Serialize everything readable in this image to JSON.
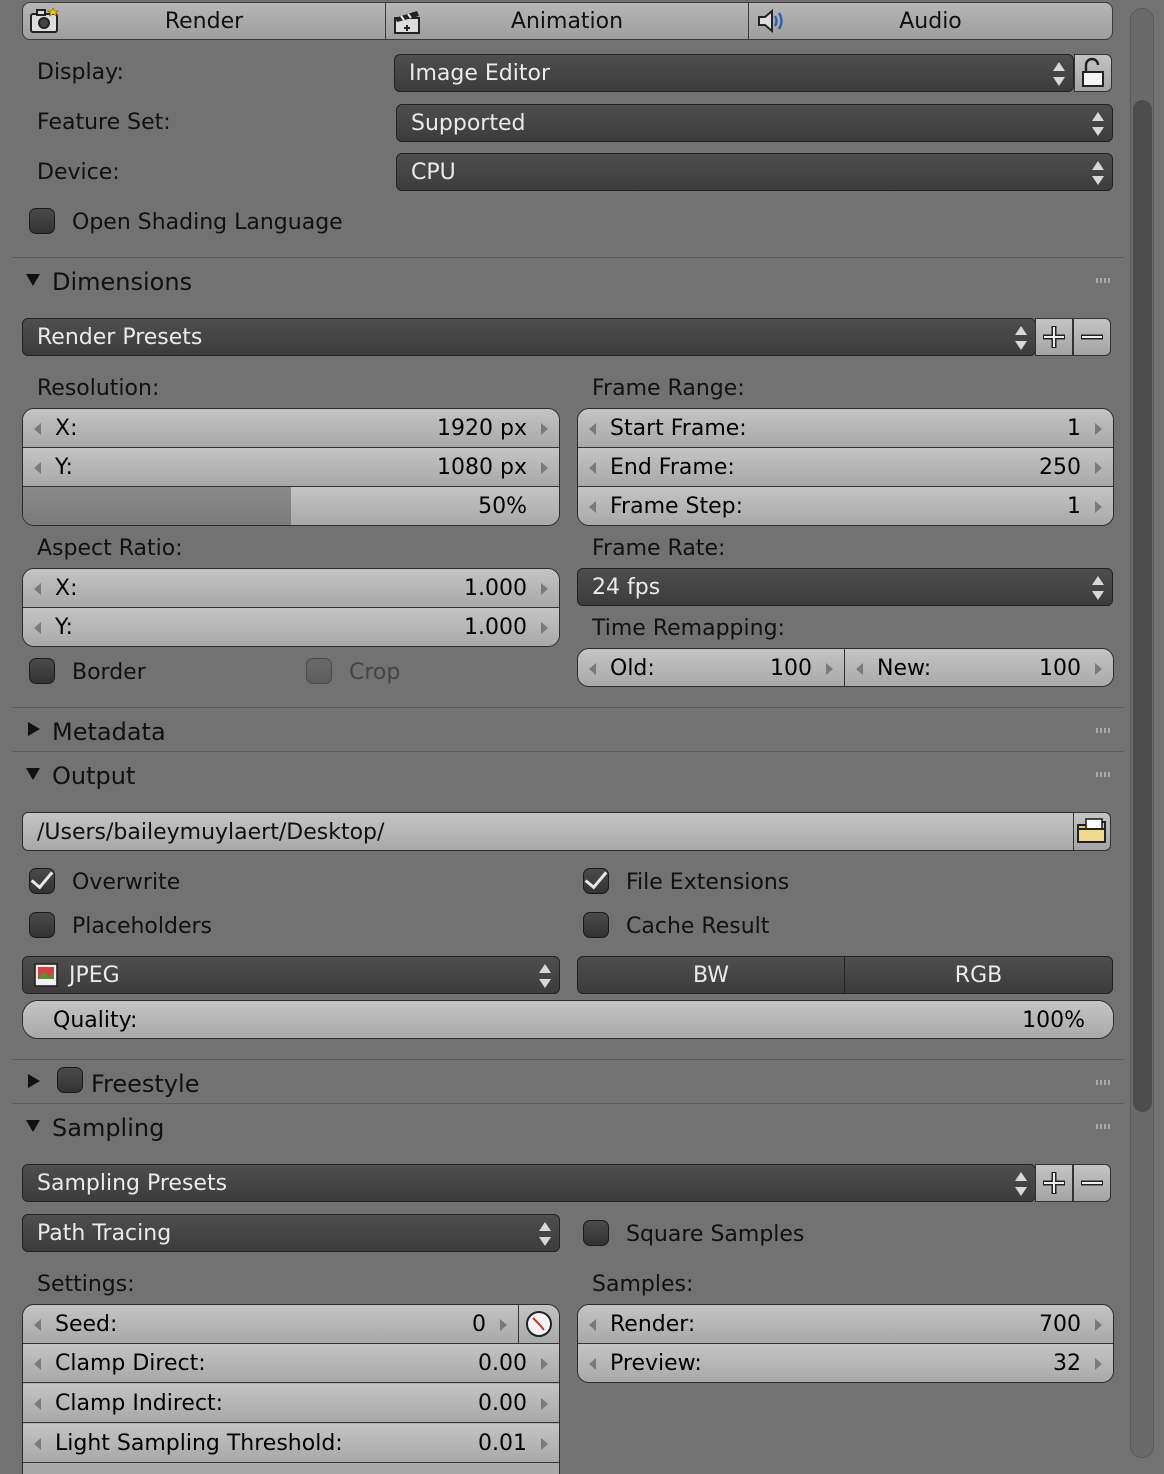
{
  "tabs": [
    {
      "label": "Render",
      "icon": "camera-icon"
    },
    {
      "label": "Animation",
      "icon": "clapperboard-icon"
    },
    {
      "label": "Audio",
      "icon": "speaker-icon"
    }
  ],
  "top": {
    "display_label": "Display:",
    "display_value": "Image Editor",
    "feature_set_label": "Feature Set:",
    "feature_set_value": "Supported",
    "device_label": "Device:",
    "device_value": "CPU",
    "osl_label": "Open Shading Language",
    "osl_checked": false
  },
  "dimensions": {
    "title": "Dimensions",
    "expanded": true,
    "presets": "Render Presets",
    "resolution_label": "Resolution:",
    "res_x_label": "X:",
    "res_x_value": "1920 px",
    "res_y_label": "Y:",
    "res_y_value": "1080 px",
    "res_percent": "50%",
    "res_percent_fraction": 0.5,
    "aspect_label": "Aspect Ratio:",
    "aspect_x_label": "X:",
    "aspect_x_value": "1.000",
    "aspect_y_label": "Y:",
    "aspect_y_value": "1.000",
    "border_label": "Border",
    "crop_label": "Crop",
    "frame_range_label": "Frame Range:",
    "start_label": "Start Frame:",
    "start_value": "1",
    "end_label": "End Frame:",
    "end_value": "250",
    "step_label": "Frame Step:",
    "step_value": "1",
    "frame_rate_label": "Frame Rate:",
    "frame_rate_value": "24 fps",
    "remap_label": "Time Remapping:",
    "old_label": "Old:",
    "old_value": "100",
    "new_label": "New:",
    "new_value": "100"
  },
  "metadata": {
    "title": "Metadata",
    "expanded": false
  },
  "output": {
    "title": "Output",
    "expanded": true,
    "path": "/Users/baileymuylaert/Desktop/",
    "overwrite_label": "Overwrite",
    "overwrite_checked": true,
    "file_ext_label": "File Extensions",
    "file_ext_checked": true,
    "placeholders_label": "Placeholders",
    "placeholders_checked": false,
    "cache_label": "Cache Result",
    "cache_checked": false,
    "format": "JPEG",
    "bw_label": "BW",
    "rgb_label": "RGB",
    "quality_label": "Quality:",
    "quality_value": "100%"
  },
  "freestyle": {
    "title": "Freestyle",
    "expanded": false,
    "checked": false
  },
  "sampling": {
    "title": "Sampling",
    "expanded": true,
    "presets": "Sampling Presets",
    "integrator": "Path Tracing",
    "square_label": "Square Samples",
    "square_checked": false,
    "settings_label": "Settings:",
    "seed_label": "Seed:",
    "seed_value": "0",
    "clamp_direct_label": "Clamp Direct:",
    "clamp_direct_value": "0.00",
    "clamp_indirect_label": "Clamp Indirect:",
    "clamp_indirect_value": "0.00",
    "light_thresh_label": "Light Sampling Threshold:",
    "light_thresh_value": "0.01",
    "samples_label": "Samples:",
    "render_label": "Render:",
    "render_value": "700",
    "preview_label": "Preview:",
    "preview_value": "32"
  }
}
